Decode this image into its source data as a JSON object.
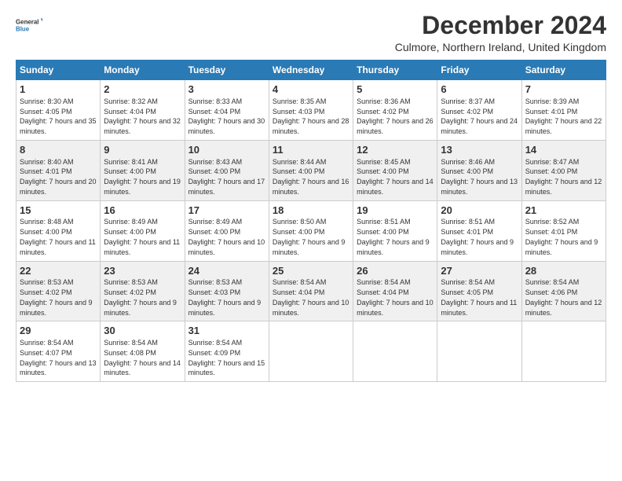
{
  "logo": {
    "general": "General",
    "blue": "Blue"
  },
  "title": "December 2024",
  "subtitle": "Culmore, Northern Ireland, United Kingdom",
  "days": [
    "Sunday",
    "Monday",
    "Tuesday",
    "Wednesday",
    "Thursday",
    "Friday",
    "Saturday"
  ],
  "weeks": [
    [
      {
        "day": "1",
        "sunrise": "8:30 AM",
        "sunset": "4:05 PM",
        "daylight": "7 hours and 35 minutes."
      },
      {
        "day": "2",
        "sunrise": "8:32 AM",
        "sunset": "4:04 PM",
        "daylight": "7 hours and 32 minutes."
      },
      {
        "day": "3",
        "sunrise": "8:33 AM",
        "sunset": "4:04 PM",
        "daylight": "7 hours and 30 minutes."
      },
      {
        "day": "4",
        "sunrise": "8:35 AM",
        "sunset": "4:03 PM",
        "daylight": "7 hours and 28 minutes."
      },
      {
        "day": "5",
        "sunrise": "8:36 AM",
        "sunset": "4:02 PM",
        "daylight": "7 hours and 26 minutes."
      },
      {
        "day": "6",
        "sunrise": "8:37 AM",
        "sunset": "4:02 PM",
        "daylight": "7 hours and 24 minutes."
      },
      {
        "day": "7",
        "sunrise": "8:39 AM",
        "sunset": "4:01 PM",
        "daylight": "7 hours and 22 minutes."
      }
    ],
    [
      {
        "day": "8",
        "sunrise": "8:40 AM",
        "sunset": "4:01 PM",
        "daylight": "7 hours and 20 minutes."
      },
      {
        "day": "9",
        "sunrise": "8:41 AM",
        "sunset": "4:00 PM",
        "daylight": "7 hours and 19 minutes."
      },
      {
        "day": "10",
        "sunrise": "8:43 AM",
        "sunset": "4:00 PM",
        "daylight": "7 hours and 17 minutes."
      },
      {
        "day": "11",
        "sunrise": "8:44 AM",
        "sunset": "4:00 PM",
        "daylight": "7 hours and 16 minutes."
      },
      {
        "day": "12",
        "sunrise": "8:45 AM",
        "sunset": "4:00 PM",
        "daylight": "7 hours and 14 minutes."
      },
      {
        "day": "13",
        "sunrise": "8:46 AM",
        "sunset": "4:00 PM",
        "daylight": "7 hours and 13 minutes."
      },
      {
        "day": "14",
        "sunrise": "8:47 AM",
        "sunset": "4:00 PM",
        "daylight": "7 hours and 12 minutes."
      }
    ],
    [
      {
        "day": "15",
        "sunrise": "8:48 AM",
        "sunset": "4:00 PM",
        "daylight": "7 hours and 11 minutes."
      },
      {
        "day": "16",
        "sunrise": "8:49 AM",
        "sunset": "4:00 PM",
        "daylight": "7 hours and 11 minutes."
      },
      {
        "day": "17",
        "sunrise": "8:49 AM",
        "sunset": "4:00 PM",
        "daylight": "7 hours and 10 minutes."
      },
      {
        "day": "18",
        "sunrise": "8:50 AM",
        "sunset": "4:00 PM",
        "daylight": "7 hours and 9 minutes."
      },
      {
        "day": "19",
        "sunrise": "8:51 AM",
        "sunset": "4:00 PM",
        "daylight": "7 hours and 9 minutes."
      },
      {
        "day": "20",
        "sunrise": "8:51 AM",
        "sunset": "4:01 PM",
        "daylight": "7 hours and 9 minutes."
      },
      {
        "day": "21",
        "sunrise": "8:52 AM",
        "sunset": "4:01 PM",
        "daylight": "7 hours and 9 minutes."
      }
    ],
    [
      {
        "day": "22",
        "sunrise": "8:53 AM",
        "sunset": "4:02 PM",
        "daylight": "7 hours and 9 minutes."
      },
      {
        "day": "23",
        "sunrise": "8:53 AM",
        "sunset": "4:02 PM",
        "daylight": "7 hours and 9 minutes."
      },
      {
        "day": "24",
        "sunrise": "8:53 AM",
        "sunset": "4:03 PM",
        "daylight": "7 hours and 9 minutes."
      },
      {
        "day": "25",
        "sunrise": "8:54 AM",
        "sunset": "4:04 PM",
        "daylight": "7 hours and 10 minutes."
      },
      {
        "day": "26",
        "sunrise": "8:54 AM",
        "sunset": "4:04 PM",
        "daylight": "7 hours and 10 minutes."
      },
      {
        "day": "27",
        "sunrise": "8:54 AM",
        "sunset": "4:05 PM",
        "daylight": "7 hours and 11 minutes."
      },
      {
        "day": "28",
        "sunrise": "8:54 AM",
        "sunset": "4:06 PM",
        "daylight": "7 hours and 12 minutes."
      }
    ],
    [
      {
        "day": "29",
        "sunrise": "8:54 AM",
        "sunset": "4:07 PM",
        "daylight": "7 hours and 13 minutes."
      },
      {
        "day": "30",
        "sunrise": "8:54 AM",
        "sunset": "4:08 PM",
        "daylight": "7 hours and 14 minutes."
      },
      {
        "day": "31",
        "sunrise": "8:54 AM",
        "sunset": "4:09 PM",
        "daylight": "7 hours and 15 minutes."
      },
      null,
      null,
      null,
      null
    ]
  ],
  "labels": {
    "sunrise": "Sunrise:",
    "sunset": "Sunset:",
    "daylight": "Daylight:"
  }
}
